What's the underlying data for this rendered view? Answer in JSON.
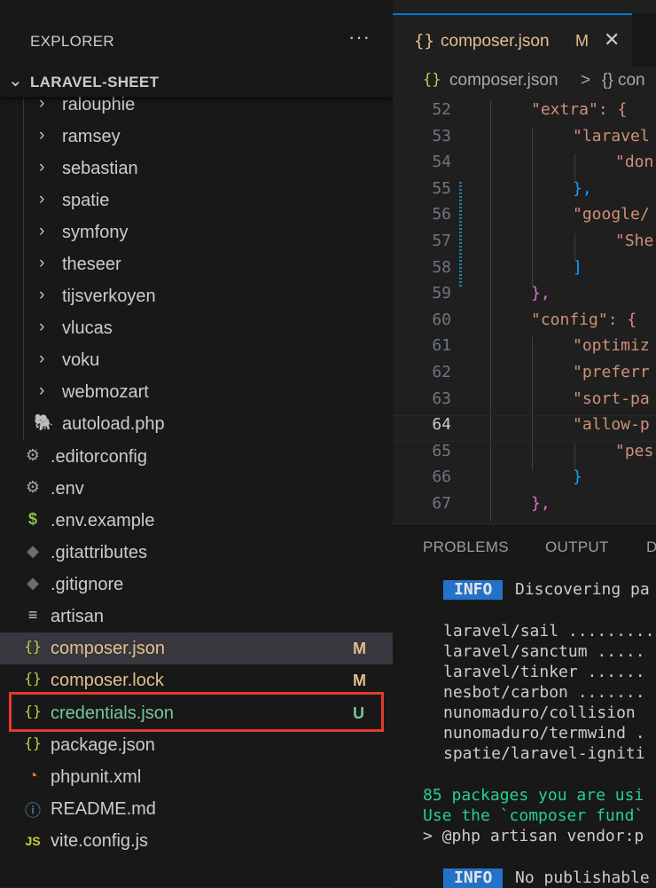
{
  "explorer": {
    "title": "EXPLORER",
    "more_label": "···",
    "project": "LARAVEL-SHEET",
    "folders": [
      "ralouphie",
      "ramsey",
      "sebastian",
      "spatie",
      "symfony",
      "theseer",
      "tijsverkoyen",
      "vlucas",
      "voku",
      "webmozart"
    ],
    "vendor_file": {
      "name": "autoload.php",
      "icon": "php-elephant-icon"
    },
    "files": [
      {
        "name": ".editorconfig",
        "icon": "gear-icon",
        "badge": "",
        "status": ""
      },
      {
        "name": ".env",
        "icon": "gear-icon",
        "badge": "",
        "status": ""
      },
      {
        "name": ".env.example",
        "icon": "dollar-icon",
        "badge": "",
        "status": ""
      },
      {
        "name": ".gitattributes",
        "icon": "git-icon",
        "badge": "",
        "status": ""
      },
      {
        "name": ".gitignore",
        "icon": "git-icon",
        "badge": "",
        "status": ""
      },
      {
        "name": "artisan",
        "icon": "lines-icon",
        "badge": "",
        "status": ""
      },
      {
        "name": "composer.json",
        "icon": "braces-icon",
        "badge": "M",
        "status": "modified"
      },
      {
        "name": "composer.lock",
        "icon": "braces-icon",
        "badge": "M",
        "status": "modified"
      },
      {
        "name": "credentials.json",
        "icon": "braces-icon",
        "badge": "U",
        "status": "untracked"
      },
      {
        "name": "package.json",
        "icon": "braces-icon",
        "badge": "",
        "status": ""
      },
      {
        "name": "phpunit.xml",
        "icon": "rss-icon",
        "badge": "",
        "status": ""
      },
      {
        "name": "README.md",
        "icon": "info-icon",
        "badge": "",
        "status": ""
      },
      {
        "name": "vite.config.js",
        "icon": "js-icon",
        "badge": "",
        "status": ""
      }
    ]
  },
  "editor": {
    "tab": {
      "label": "composer.json",
      "status": "M"
    },
    "breadcrumb": {
      "file": "composer.json",
      "sep": ">",
      "next": "{} con"
    },
    "current_line": 64,
    "lines": [
      {
        "n": 52,
        "text": "\"extra\": {"
      },
      {
        "n": 53,
        "text": "\"laravel"
      },
      {
        "n": 54,
        "text": "\"don"
      },
      {
        "n": 55,
        "text": "},"
      },
      {
        "n": 56,
        "text": "\"google/"
      },
      {
        "n": 57,
        "text": "\"She"
      },
      {
        "n": 58,
        "text": "]"
      },
      {
        "n": 59,
        "text": "},"
      },
      {
        "n": 60,
        "text": "\"config\": {"
      },
      {
        "n": 61,
        "text": "\"optimiz"
      },
      {
        "n": 62,
        "text": "\"preferr"
      },
      {
        "n": 63,
        "text": "\"sort-pa"
      },
      {
        "n": 64,
        "text": "\"allow-p"
      },
      {
        "n": 65,
        "text": "\"pes"
      },
      {
        "n": 66,
        "text": "}"
      },
      {
        "n": 67,
        "text": "},"
      }
    ]
  },
  "panel": {
    "tabs": [
      "PROBLEMS",
      "OUTPUT",
      "D"
    ],
    "info1_badge": "INFO",
    "info1_text": "Discovering pa",
    "packages": [
      "laravel/sail .........",
      "laravel/sanctum .....",
      "laravel/tinker ......",
      "nesbot/carbon .......",
      "nunomaduro/collision",
      "nunomaduro/termwind .",
      "spatie/laravel-igniti"
    ],
    "fund1": "85 packages you are usi",
    "fund2": "Use the `composer fund`",
    "cmd": "> @php artisan vendor:p",
    "info2_badge": "INFO",
    "info2_text": "No publishable"
  }
}
